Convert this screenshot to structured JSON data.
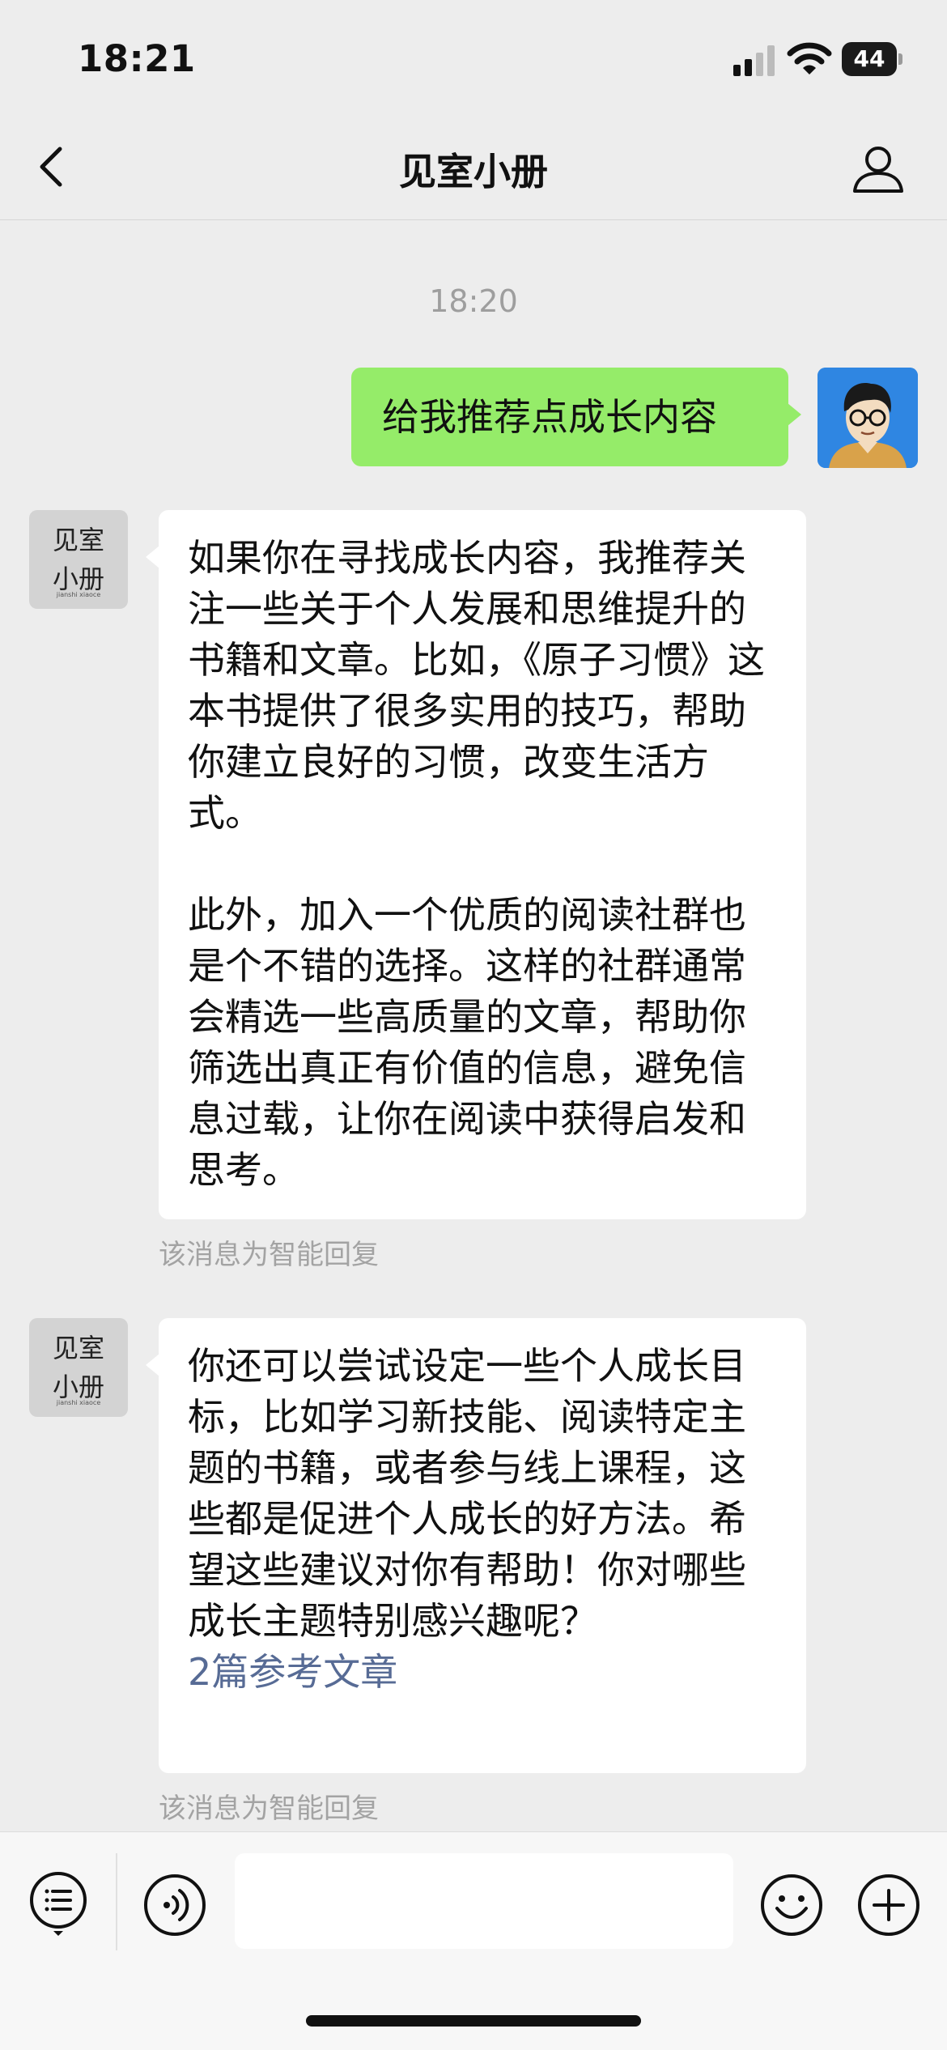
{
  "status_bar": {
    "time": "18:21",
    "battery": "44",
    "icons": [
      "signal-icon",
      "wifi-icon",
      "battery-icon"
    ]
  },
  "nav": {
    "title": "见室小册",
    "back_icon": "chevron-left-icon",
    "profile_icon": "person-icon"
  },
  "chat": {
    "timestamp": "18:20",
    "outgoing": {
      "text": "给我推荐点成长内容"
    },
    "bot_avatar": {
      "line1": "见室",
      "line2": "小册",
      "sub": "jianshi xiaoce"
    },
    "messages": [
      {
        "paragraphs": [
          "如果你在寻找成长内容，我推荐关注一些关于个人发展和思维提升的书籍和文章。比如，《原子习惯》这本书提供了很多实用的技巧，帮助你建立良好的习惯，改变生活方式。",
          "此外，加入一个优质的阅读社群也是个不错的选择。这样的社群通常会精选一些高质量的文章，帮助你筛选出真正有价值的信息，避免信息过载，让你在阅读中获得启发和思考。"
        ],
        "note": "该消息为智能回复"
      },
      {
        "paragraphs": [
          "你还可以尝试设定一些个人成长目标，比如学习新技能、阅读特定主题的书籍，或者参与线上课程，这些都是促进个人成长的好方法。希望这些建议对你有帮助！你对哪些成长主题特别感兴趣呢？"
        ],
        "link": "2篇参考文章",
        "note": "该消息为智能回复"
      }
    ]
  },
  "input_bar": {
    "menu_icon": "menu-list-icon",
    "voice_icon": "voice-icon",
    "emoji_icon": "emoji-icon",
    "plus_icon": "plus-icon",
    "input_value": ""
  },
  "colors": {
    "background": "#ededed",
    "outgoing_bubble": "#95ec69",
    "incoming_bubble": "#ffffff",
    "link": "#576b95",
    "muted": "#a3a3a3"
  }
}
